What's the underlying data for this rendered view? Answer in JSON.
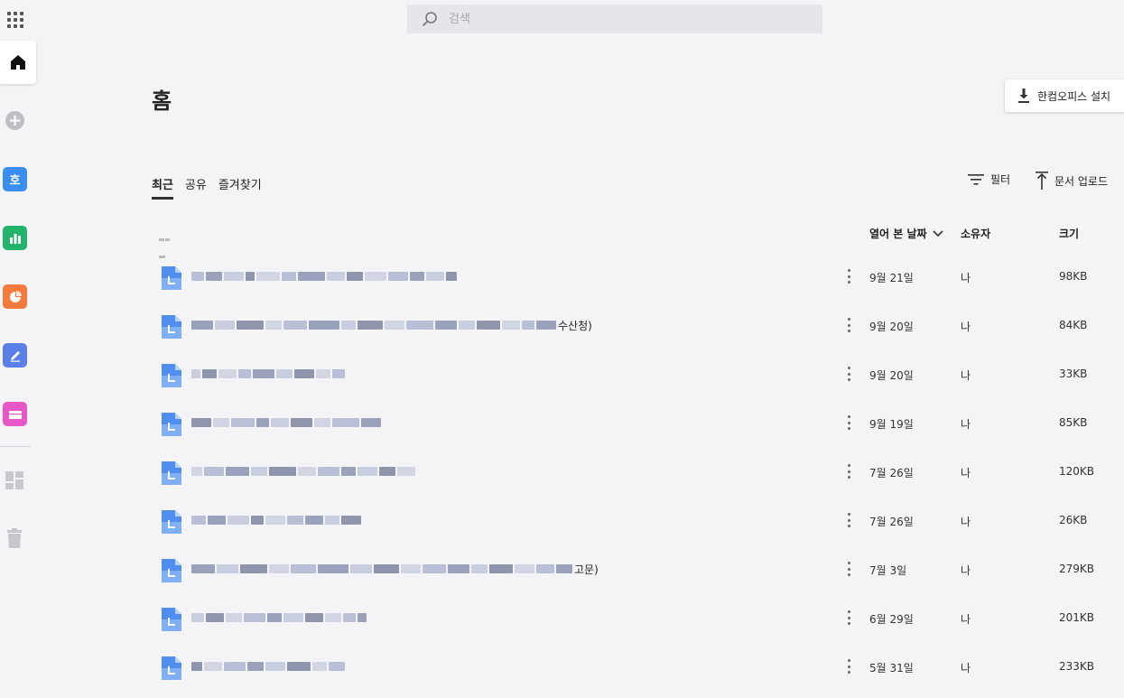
{
  "search": {
    "placeholder": "검색"
  },
  "page": {
    "title": "홈"
  },
  "install_button": {
    "label": "한컴오피스 설치"
  },
  "tabs": [
    {
      "label": "최근",
      "active": true
    },
    {
      "label": "공유",
      "active": false
    },
    {
      "label": "즐겨찾기",
      "active": false
    }
  ],
  "toolbar": {
    "filter_label": "필터",
    "upload_label": "문서 업로드"
  },
  "columns": {
    "opened": "열어 본 날짜",
    "owner": "소유자",
    "size": "크기"
  },
  "sidebar_apps": [
    {
      "name": "hanword-icon",
      "color": "#3a8ef0"
    },
    {
      "name": "hancell-icon",
      "color": "#23b36b"
    },
    {
      "name": "hanshow-icon",
      "color": "#f47a3d"
    },
    {
      "name": "hanwrite-icon",
      "color": "#5a7fe6"
    },
    {
      "name": "hanbox-icon",
      "color": "#e857c8"
    }
  ],
  "files": [
    {
      "suffix": "",
      "date": "9월 21일",
      "owner": "나",
      "size": "98KB"
    },
    {
      "suffix": "수산청)",
      "date": "9월 20일",
      "owner": "나",
      "size": "84KB"
    },
    {
      "suffix": "",
      "date": "9월 20일",
      "owner": "나",
      "size": "33KB"
    },
    {
      "suffix": "",
      "date": "9월 19일",
      "owner": "나",
      "size": "85KB"
    },
    {
      "suffix": "",
      "date": "7월 26일",
      "owner": "나",
      "size": "120KB"
    },
    {
      "suffix": "",
      "date": "7월 26일",
      "owner": "나",
      "size": "26KB"
    },
    {
      "suffix": "고문)",
      "date": "7월 3일",
      "owner": "나",
      "size": "279KB"
    },
    {
      "suffix": "",
      "date": "6월 29일",
      "owner": "나",
      "size": "201KB"
    },
    {
      "suffix": "",
      "date": "5월 31일",
      "owner": "나",
      "size": "233KB"
    }
  ]
}
